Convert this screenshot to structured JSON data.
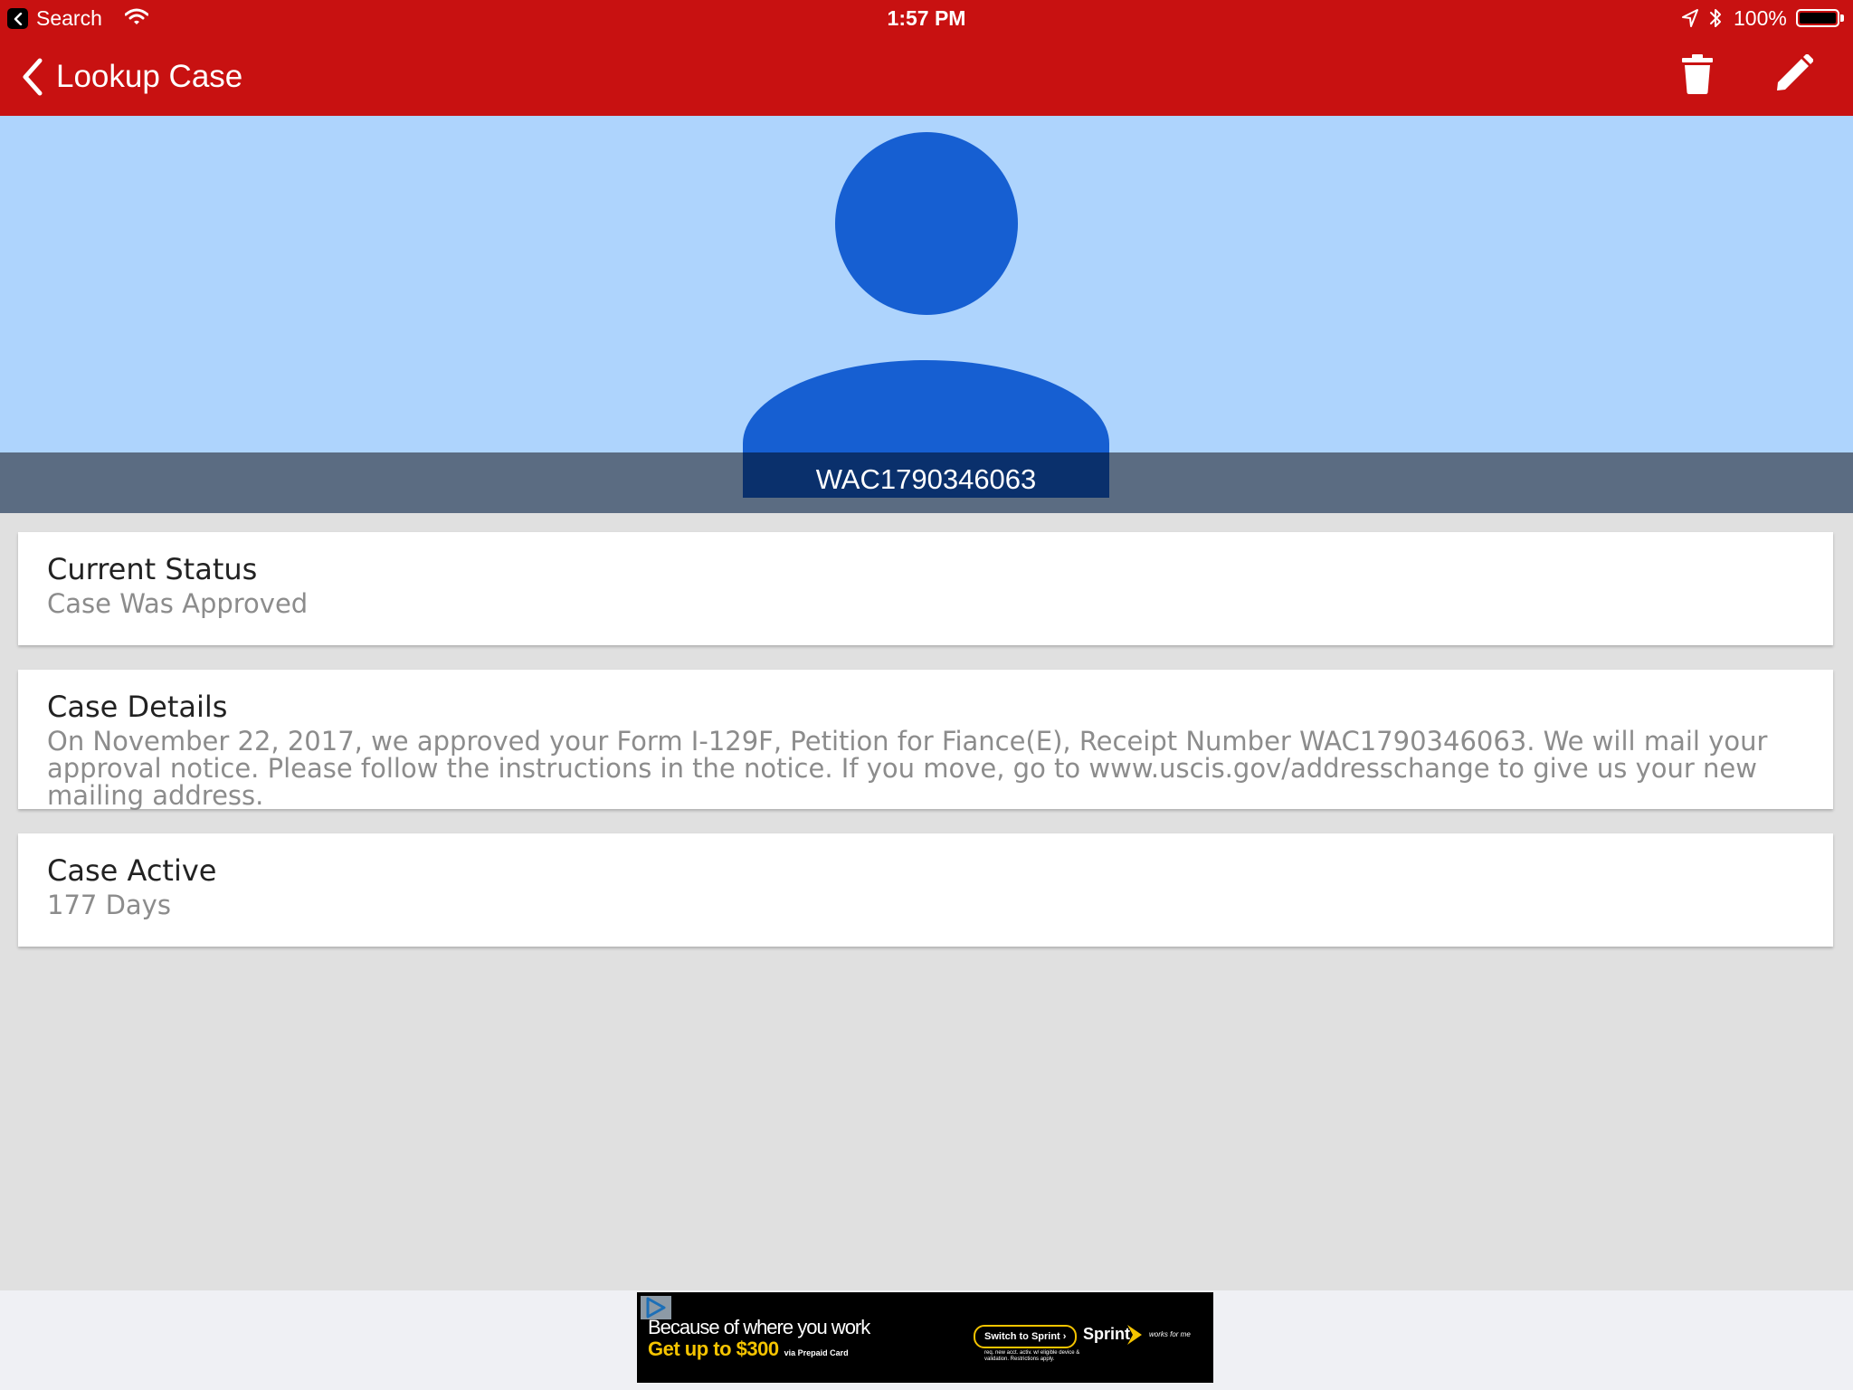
{
  "status_bar": {
    "back_label": "Search",
    "time": "1:57 PM",
    "battery_text": "100%",
    "battery_level": 1.0,
    "icons": [
      "back-arrow-icon",
      "wifi-icon",
      "location-arrow-icon",
      "bluetooth-icon",
      "battery-icon"
    ]
  },
  "nav": {
    "title": "Lookup Case",
    "icons": [
      "chevron-left-icon",
      "trash-icon",
      "pencil-icon"
    ]
  },
  "profile": {
    "case_number": "WAC1790346063",
    "icon": "person-silhouette-icon"
  },
  "cards": {
    "status": {
      "title": "Current Status",
      "value": "Case Was Approved"
    },
    "details": {
      "title": "Case Details",
      "value": "On November 22, 2017, we approved your Form I-129F, Petition for Fiance(E), Receipt Number WAC1790346063. We will mail your approval notice. Please follow the instructions in the notice. If you move, go to www.uscis.gov/addresschange to give us your new mailing address."
    },
    "active": {
      "title": "Case Active",
      "value": "177 Days"
    }
  },
  "ad": {
    "line1": "Because of where you work",
    "line2": "Get up to $300",
    "line2_small": "via Prepaid Card",
    "cta": "Switch to Sprint ›",
    "fine_print": "req. new acct. activ. w/ eligible device & validation. Restrictions apply.",
    "brand": "Sprint",
    "tagline": "works for me"
  },
  "colors": {
    "nav_red": "#c81111",
    "hero_light_blue": "#aed4fd",
    "avatar_blue": "#165fd2",
    "id_band": "#5b6c82",
    "id_box": "#0a306c",
    "page_bg": "#e0e0e0",
    "ad_yellow": "#f5c400"
  }
}
